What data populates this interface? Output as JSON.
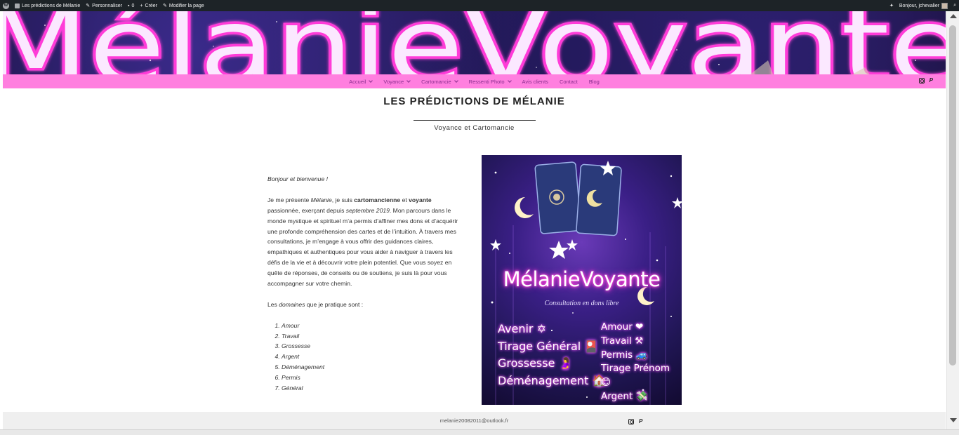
{
  "adminbar": {
    "site_name": "Les prédictions de Mélanie",
    "customize": "Personnaliser",
    "comments_count": "0",
    "new": "Créer",
    "edit_page": "Modifier la page",
    "greeting": "Bonjour, jchevalier"
  },
  "banner": {
    "logo_text": "MélanieVoyante"
  },
  "nav": {
    "items": [
      {
        "label": "Accueil",
        "dropdown": true
      },
      {
        "label": "Voyance",
        "dropdown": true
      },
      {
        "label": "Cartomancie",
        "dropdown": true
      },
      {
        "label": "Ressenti Photo",
        "dropdown": true
      },
      {
        "label": "Avis clients",
        "dropdown": false
      },
      {
        "label": "Contact",
        "dropdown": false
      },
      {
        "label": "Blog",
        "dropdown": false
      }
    ],
    "social": [
      "instagram-icon",
      "paypal-icon"
    ]
  },
  "site": {
    "title": "LES PRÉDICTIONS DE MÉLANIE",
    "tagline": "Voyance et Cartomancie"
  },
  "content": {
    "greeting": "Bonjour et bienvenue !",
    "intro_1": "Je me présente ",
    "intro_name": "Mélanie",
    "intro_2": ", je suis ",
    "intro_role1": "cartomancienne",
    "intro_3": " et ",
    "intro_role2": "voyante",
    "intro_4": " passionnée, exerçant depuis ",
    "intro_date": "septembre 2019",
    "intro_5": ". Mon parcours dans le monde mystique et spirituel m’a permis d’affiner mes dons et d’acquérir une profonde compréhension des cartes et de l’intuition. À travers mes consultations, je m’engage à vous offrir des guidances claires, empathiques et authentiques pour vous aider à naviguer à travers les défis de la vie et à découvrir votre plein potentiel. Que vous soyez en quête de réponses, de conseils ou de soutiens, je suis là pour vous accompagner sur votre chemin.",
    "domains_1": "Les ",
    "domains_em": "domaines",
    "domains_2": " que je pratique sont :",
    "domains": [
      "Amour",
      "Travail",
      "Grossesse",
      "Argent",
      "Déménagement",
      "Permis",
      "Général"
    ]
  },
  "hero": {
    "brand": "MélanieVoyante",
    "subtitle": "Consultation en dons libre",
    "left_list": [
      "Avenir ✡",
      "Tirage Général 🎴",
      "Grossesse 🤰",
      "Déménagement 🏠"
    ],
    "right_list": [
      "Amour ❤",
      "Travail ⚒",
      "Permis 🚙",
      "Tirage Prénom 😊",
      "Argent 💸"
    ]
  },
  "footer": {
    "email": "melanie20082011@outlook.fr",
    "social": [
      "instagram-icon",
      "paypal-icon"
    ]
  },
  "colors": {
    "nav_bg": "#ff7fdf",
    "nav_text": "#8a2f8f",
    "adminbar_bg": "#1d2327",
    "neon_pink": "#ff3ad8"
  }
}
